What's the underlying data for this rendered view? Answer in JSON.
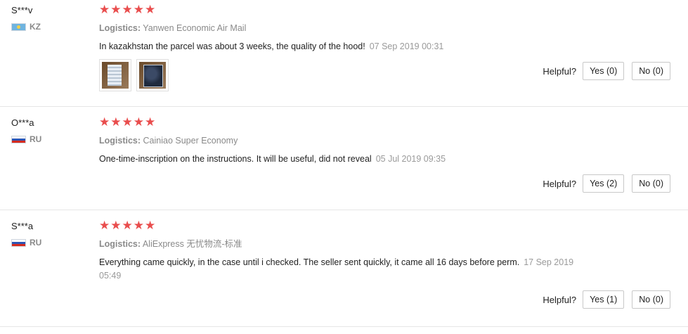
{
  "helpful_label": "Helpful?",
  "star_color": "#e94d4d",
  "reviews": [
    {
      "user": "S***v",
      "country": "KZ",
      "rating": 5,
      "logistics_label": "Logistics:",
      "logistics": "Yanwen Economic Air Mail",
      "text": "In kazakhstan the parcel was about 3 weeks, the quality of the hood!",
      "date": "07 Sep 2019 00:31",
      "photo_count": 2,
      "yes_label": "Yes (0)",
      "no_label": "No (0)"
    },
    {
      "user": "O***a",
      "country": "RU",
      "rating": 5,
      "logistics_label": "Logistics:",
      "logistics": "Cainiao Super Economy",
      "text": "One-time-inscription on the instructions. It will be useful, did not reveal",
      "date": "05 Jul 2019 09:35",
      "yes_label": "Yes (2)",
      "no_label": "No (0)"
    },
    {
      "user": "S***a",
      "country": "RU",
      "rating": 5,
      "logistics_label": "Logistics:",
      "logistics": "AliExpress 无忧物流-标准",
      "text": "Everything came quickly, in the case until i checked. The seller sent quickly, it came all 16 days before perm.",
      "date": "17 Sep 2019 05:49",
      "yes_label": "Yes (1)",
      "no_label": "No (0)"
    }
  ]
}
